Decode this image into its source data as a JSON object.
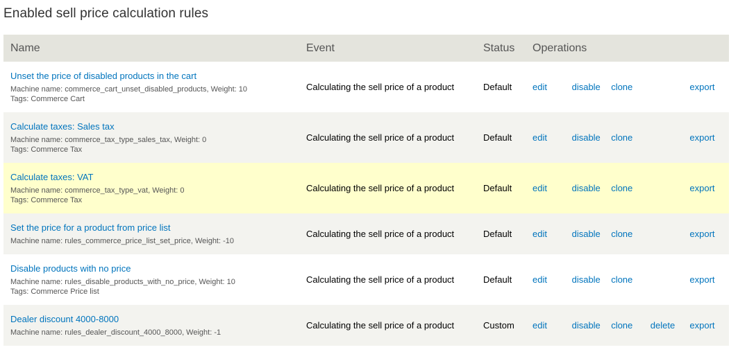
{
  "page": {
    "title": "Enabled sell price calculation rules"
  },
  "table": {
    "headers": {
      "name": "Name",
      "event": "Event",
      "status": "Status",
      "operations": "Operations"
    },
    "rows": [
      {
        "name": "Unset the price of disabled products in the cart",
        "machine": "Machine name: commerce_cart_unset_disabled_products, Weight: 10",
        "tags": "Tags: Commerce Cart",
        "event": "Calculating the sell price of a product",
        "status": "Default",
        "ops": {
          "edit": "edit",
          "disable": "disable",
          "clone": "clone",
          "delete": "",
          "export": "export"
        }
      },
      {
        "name": "Calculate taxes: Sales tax",
        "machine": "Machine name: commerce_tax_type_sales_tax, Weight: 0",
        "tags": "Tags: Commerce Tax",
        "event": "Calculating the sell price of a product",
        "status": "Default",
        "ops": {
          "edit": "edit",
          "disable": "disable",
          "clone": "clone",
          "delete": "",
          "export": "export"
        }
      },
      {
        "name": "Calculate taxes: VAT",
        "machine": "Machine name: commerce_tax_type_vat, Weight: 0",
        "tags": "Tags: Commerce Tax",
        "event": "Calculating the sell price of a product",
        "status": "Default",
        "ops": {
          "edit": "edit",
          "disable": "disable",
          "clone": "clone",
          "delete": "",
          "export": "export"
        }
      },
      {
        "name": "Set the price for a product from price list",
        "machine": "Machine name: rules_commerce_price_list_set_price, Weight: -10",
        "tags": "",
        "event": "Calculating the sell price of a product",
        "status": "Default",
        "ops": {
          "edit": "edit",
          "disable": "disable",
          "clone": "clone",
          "delete": "",
          "export": "export"
        }
      },
      {
        "name": "Disable products with no price",
        "machine": "Machine name: rules_disable_products_with_no_price, Weight: 10",
        "tags": "Tags: Commerce Price list",
        "event": "Calculating the sell price of a product",
        "status": "Default",
        "ops": {
          "edit": "edit",
          "disable": "disable",
          "clone": "clone",
          "delete": "",
          "export": "export"
        }
      },
      {
        "name": "Dealer discount 4000-8000",
        "machine": "Machine name: rules_dealer_discount_4000_8000, Weight: -1",
        "tags": "",
        "event": "Calculating the sell price of a product",
        "status": "Custom",
        "ops": {
          "edit": "edit",
          "disable": "disable",
          "clone": "clone",
          "delete": "delete",
          "export": "export"
        }
      }
    ]
  },
  "colors": {
    "link": "#0074bd",
    "header_bg": "#e4e4dd",
    "row_alt_bg": "#f3f3ef",
    "row_highlight_bg": "#ffffcc"
  }
}
